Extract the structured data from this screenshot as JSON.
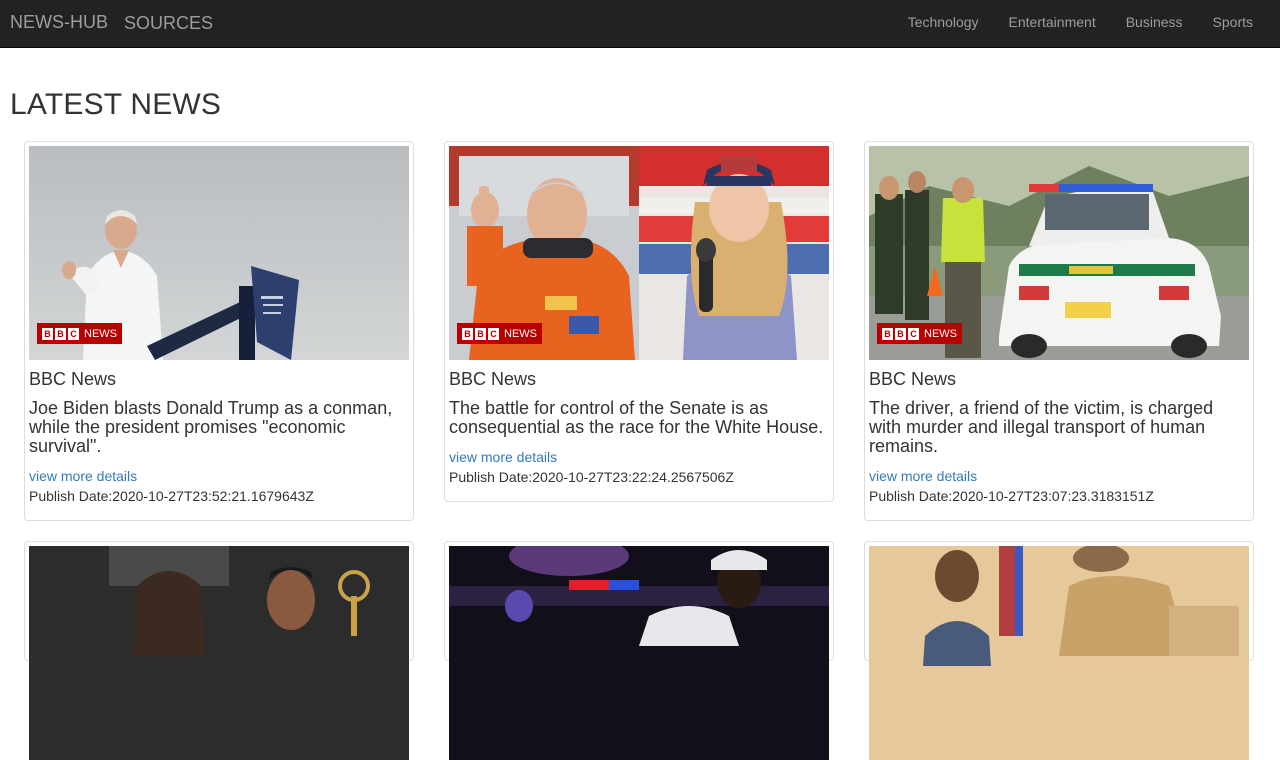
{
  "nav": {
    "brand": "NEWS-HUB",
    "sources": "SOURCES",
    "categories": [
      "Technology",
      "Entertainment",
      "Business",
      "Sports"
    ]
  },
  "page": {
    "title": "LATEST NEWS"
  },
  "badge": {
    "letters": [
      "B",
      "B",
      "C"
    ],
    "word": "NEWS"
  },
  "cards": [
    {
      "source": "BBC News",
      "headline": "Joe Biden blasts Donald Trump as a conman, while the president promises \"economic survival\".",
      "more": "view more details",
      "date": "Publish Date:2020-10-27T23:52:21.1679643Z",
      "image": "biden-podium-image"
    },
    {
      "source": "BBC News",
      "headline": "The battle for control of the Senate is as consequential as the race for the White House.",
      "more": "view more details",
      "date": "Publish Date:2020-10-27T23:22:24.2567506Z",
      "image": "senate-candidates-image"
    },
    {
      "source": "BBC News",
      "headline": "The driver, a friend of the victim, is charged with murder and illegal transport of human remains.",
      "more": "view more details",
      "date": "Publish Date:2020-10-27T23:07:23.3183151Z",
      "image": "police-car-image"
    }
  ],
  "colors": {
    "navbar": "#222222",
    "nav_text": "#9d9d9d",
    "link": "#337ab7",
    "bbc_red": "#b80000"
  }
}
